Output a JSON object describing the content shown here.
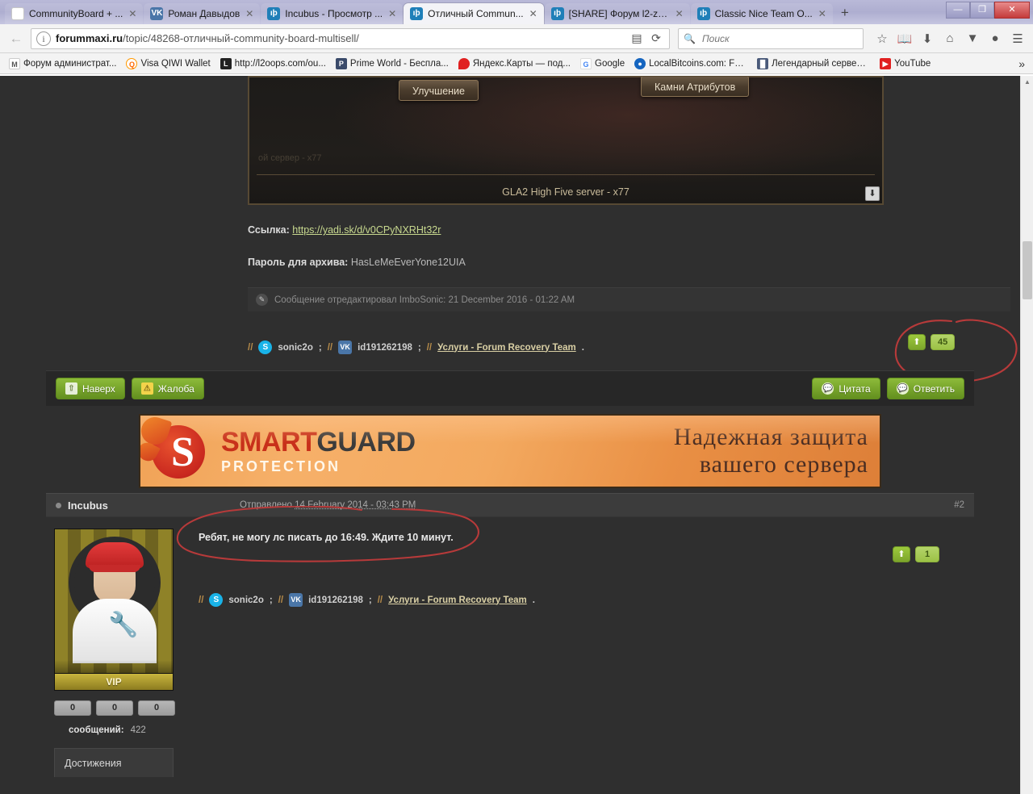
{
  "window": {
    "controls": {
      "minimize": "—",
      "maximize": "❐",
      "close": "✕"
    }
  },
  "tabs": [
    {
      "title": "CommunityBoard + ...",
      "favicon": "m-logo-icon",
      "active": false,
      "close": "✕"
    },
    {
      "title": "Роман Давыдов",
      "favicon": "vk-icon",
      "active": false,
      "close": "✕"
    },
    {
      "title": "Incubus - Просмотр ...",
      "favicon": "forum-icon",
      "active": false,
      "close": "✕"
    },
    {
      "title": "Отличный Commun...",
      "favicon": "forum-icon",
      "active": true,
      "close": "✕"
    },
    {
      "title": "[SHARE] Форум l2-ze...",
      "favicon": "forum-icon",
      "active": false,
      "close": "✕"
    },
    {
      "title": "Classic Nice Team O...",
      "favicon": "forum-icon",
      "active": false,
      "close": "✕"
    }
  ],
  "newtab_label": "+",
  "navbar": {
    "back_icon": "←",
    "url_host": "forummaxi.ru",
    "url_path": "/topic/48268-отличный-community-board-multisell/",
    "info_icon": "i",
    "reader_icon": "▤",
    "reload_icon": "⟳",
    "search_placeholder": "Поиск",
    "search_value": "",
    "icons": [
      "star-icon",
      "library-icon",
      "download-icon",
      "home-icon",
      "pocket-icon",
      "sync-icon",
      "menu-icon"
    ]
  },
  "bookmarks": [
    {
      "label": "Форум администрат...",
      "icon": "m-logo-icon",
      "color": "#ffffff"
    },
    {
      "label": "Visa QIWI Wallet",
      "icon": "qiwi-icon",
      "color": "#ff8c00"
    },
    {
      "label": "http://l2oops.com/ou...",
      "icon": "l2-icon",
      "color": "#222222"
    },
    {
      "label": "Prime World - Беспла...",
      "icon": "primeworld-icon",
      "color": "#3a4a6a"
    },
    {
      "label": "Яндекс.Карты — под...",
      "icon": "map-pin-icon",
      "color": "#e02020"
    },
    {
      "label": "Google",
      "icon": "google-icon",
      "color": "#ffffff"
    },
    {
      "label": "LocalBitcoins.com: Fa...",
      "icon": "localbitcoins-icon",
      "color": "#1565c0"
    },
    {
      "label": "Легендарный сервер ...",
      "icon": "server-icon",
      "color": "#4a5a7a"
    },
    {
      "label": "YouTube",
      "icon": "youtube-icon",
      "color": "#e02020"
    }
  ],
  "bookmarks_overflow": "»",
  "post1": {
    "signature_image": {
      "button_left": "Улучшение",
      "button_right": "Камни Атрибутов",
      "faint_text": "ой сервер - x77",
      "caption": "GLA2 High Five server - x77",
      "download_icon": "⬇"
    },
    "link_label": "Ссылка:",
    "link_url": "https://yadi.sk/d/v0CPyNXRHt32r",
    "password_label": "Пароль для архива:",
    "password_value": "HasLeMeEverYone12UIA",
    "edit_note": "Сообщение отредактировал ImboSonic: 21 December 2016 - 01:22 AM",
    "edit_icon": "✎",
    "signature": {
      "sep": "//",
      "skype_icon": "S",
      "skype_name": "sonic2o",
      "semicolon": ";",
      "vk_icon": "VK",
      "vk_id": "id191262198",
      "link_text": "Услуги - Forum Recovery Team",
      "period": "."
    },
    "rep": {
      "up_icon": "⬆",
      "count": "45"
    }
  },
  "actionbar": {
    "left": [
      {
        "label": "Наверх",
        "icon": "up-arrow-icon"
      },
      {
        "label": "Жалоба",
        "icon": "warning-icon"
      }
    ],
    "right": [
      {
        "label": "Цитата",
        "icon": "quote-icon"
      },
      {
        "label": "Ответить",
        "icon": "reply-icon"
      }
    ]
  },
  "banner": {
    "word1": "SMART",
    "word2": "GUARD",
    "subtitle": "PROTECTION",
    "logo_letter": "S",
    "tagline_line1": "Надежная защита",
    "tagline_line2": "вашего сервера"
  },
  "post2": {
    "username": "Incubus",
    "sent_label": "Отправлено",
    "sent_date": "14 February 2014 - 03:43 PM",
    "post_number": "#2",
    "message": "Ребят, не могу лс писать до 16:49. Ждите 10 минут.",
    "author": {
      "rank": "VIP",
      "pips": [
        "0",
        "0",
        "0"
      ],
      "messages_label": "сообщений:",
      "messages_count": "422",
      "achievements_label": "Достижения"
    },
    "signature": {
      "sep": "//",
      "skype_icon": "S",
      "skype_name": "sonic2o",
      "semicolon": ";",
      "vk_icon": "VK",
      "vk_id": "id191262198",
      "link_text": "Услуги - Forum Recovery Team",
      "period": "."
    },
    "rep": {
      "up_icon": "⬆",
      "count": "1"
    }
  },
  "scrollbar": {
    "up": "▲",
    "down": "▼"
  },
  "colors": {
    "accent_green": "#7aa72d",
    "rep_green": "#9cc93c",
    "annotation_red": "#c0392b",
    "link_green": "#c8d98f",
    "banner_orange": "#f0a256"
  }
}
